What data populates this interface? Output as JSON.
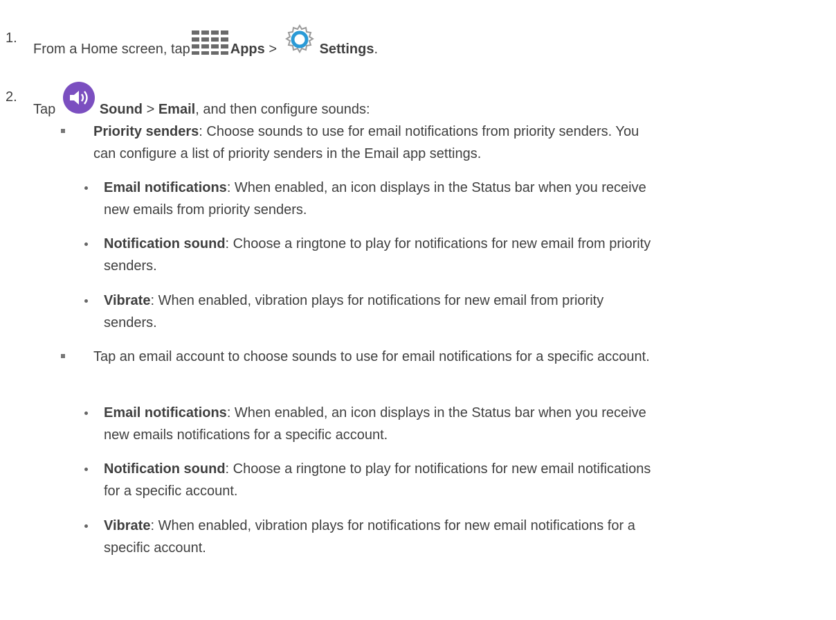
{
  "step1": {
    "num": "1.",
    "pre": "From a Home screen, tap",
    "apps": "Apps",
    "sep": ">",
    "settings": "Settings",
    "end": "."
  },
  "step2": {
    "num": "2.",
    "pre": "Tap",
    "sound": "Sound",
    "sep": ">",
    "email": "Email",
    "post": ", and then configure sounds:"
  },
  "priority": {
    "title": "Priority senders",
    "line1": ": Choose sounds to use for email notifications from priority senders. You",
    "line2": "can configure a list of priority senders in the Email app settings.",
    "items": [
      {
        "title": "Email notifications",
        "line1": ": When enabled, an icon displays in the Status bar when you receive",
        "line2": "new emails from priority senders."
      },
      {
        "title": "Notification sound",
        "line1": ": Choose a ringtone to play for notifications for new email from priority",
        "line2": "senders."
      },
      {
        "title": "Vibrate",
        "line1": ": When enabled, vibration plays for notifications for new email from priority",
        "line2": "senders."
      }
    ]
  },
  "account": {
    "text": "Tap an email account to choose sounds to use for email notifications for a specific account.",
    "items": [
      {
        "title": "Email notifications",
        "line1": ": When enabled, an icon displays in the Status bar when you receive",
        "line2": "new emails notifications for a specific account."
      },
      {
        "title": "Notification sound",
        "line1": ": Choose a ringtone to play for notifications for new email notifications",
        "line2": "for a specific account."
      },
      {
        "title": "Vibrate",
        "line1": ": When enabled, vibration plays for notifications for new email notifications for a",
        "line2": "specific account."
      }
    ]
  },
  "colors": {
    "text": "#3f3f3f",
    "sound_icon": "#7b4fc0",
    "settings_icon": "#2a9ad6",
    "apps_icon": "#6a6a6a"
  },
  "icons": {
    "apps": "apps-grid-icon",
    "settings": "settings-gear-icon",
    "sound": "sound-speaker-icon"
  }
}
